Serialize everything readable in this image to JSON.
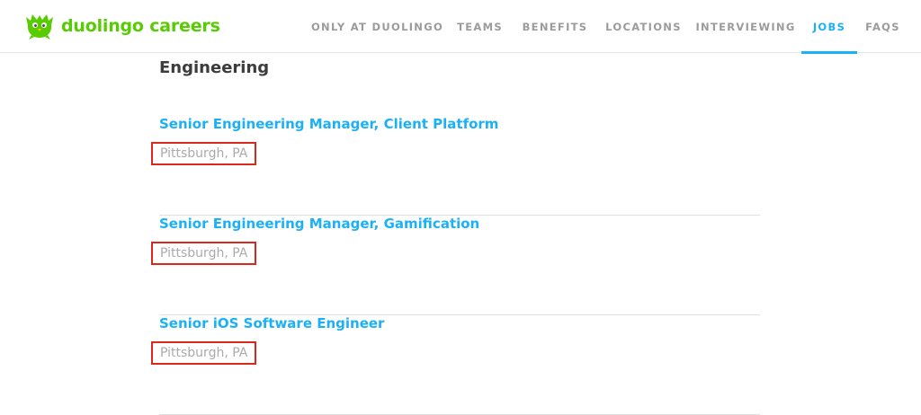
{
  "brand": {
    "name": "duolingo careers",
    "color": "#58cc02"
  },
  "nav": {
    "items": [
      {
        "label": "ONLY AT DUOLINGO"
      },
      {
        "label": "TEAMS"
      },
      {
        "label": "BENEFITS"
      },
      {
        "label": "LOCATIONS"
      },
      {
        "label": "INTERVIEWING"
      },
      {
        "label": "JOBS",
        "active": true
      },
      {
        "label": "FAQS"
      }
    ],
    "active_color": "#1cb0f6"
  },
  "section": {
    "title": "Engineering",
    "jobs": [
      {
        "title": "Senior Engineering Manager, Client Platform",
        "location": "Pittsburgh, PA"
      },
      {
        "title": "Senior Engineering Manager, Gamification",
        "location": "Pittsburgh, PA"
      },
      {
        "title": "Senior iOS Software Engineer",
        "location": "Pittsburgh, PA"
      }
    ]
  },
  "highlight_color": "#d9291c"
}
